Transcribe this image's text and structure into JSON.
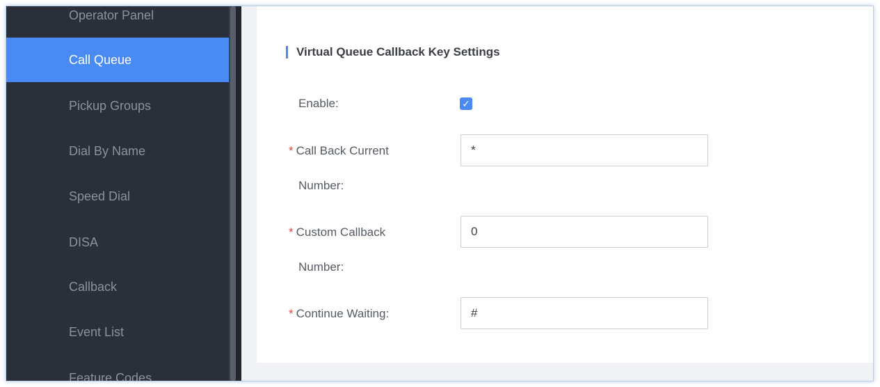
{
  "sidebar": {
    "items": [
      {
        "label": "Operator Panel"
      },
      {
        "label": "Call Queue"
      },
      {
        "label": "Pickup Groups"
      },
      {
        "label": "Dial By Name"
      },
      {
        "label": "Speed Dial"
      },
      {
        "label": "DISA"
      },
      {
        "label": "Callback"
      },
      {
        "label": "Event List"
      },
      {
        "label": "Feature Codes"
      }
    ],
    "active_item": "Call Queue"
  },
  "main": {
    "section_title": "Virtual Queue Callback Key Settings",
    "fields": {
      "enable": {
        "label": "Enable",
        "suffix": ":",
        "checked": true
      },
      "call_back_current": {
        "label_line1": "Call Back Current",
        "label_line2": "Number",
        "suffix": ":",
        "required_mark": "*",
        "value": "*"
      },
      "custom_callback": {
        "label_line1": "Custom Callback",
        "label_line2": "Number",
        "suffix": ":",
        "required_mark": "*",
        "value": "0"
      },
      "continue_waiting": {
        "label": "Continue Waiting",
        "suffix": ":",
        "required_mark": "*",
        "value": "#"
      }
    }
  },
  "colors": {
    "sidebar_bg": "#2b2f3a",
    "accent": "#4a8af4",
    "required": "#e04a3f"
  }
}
